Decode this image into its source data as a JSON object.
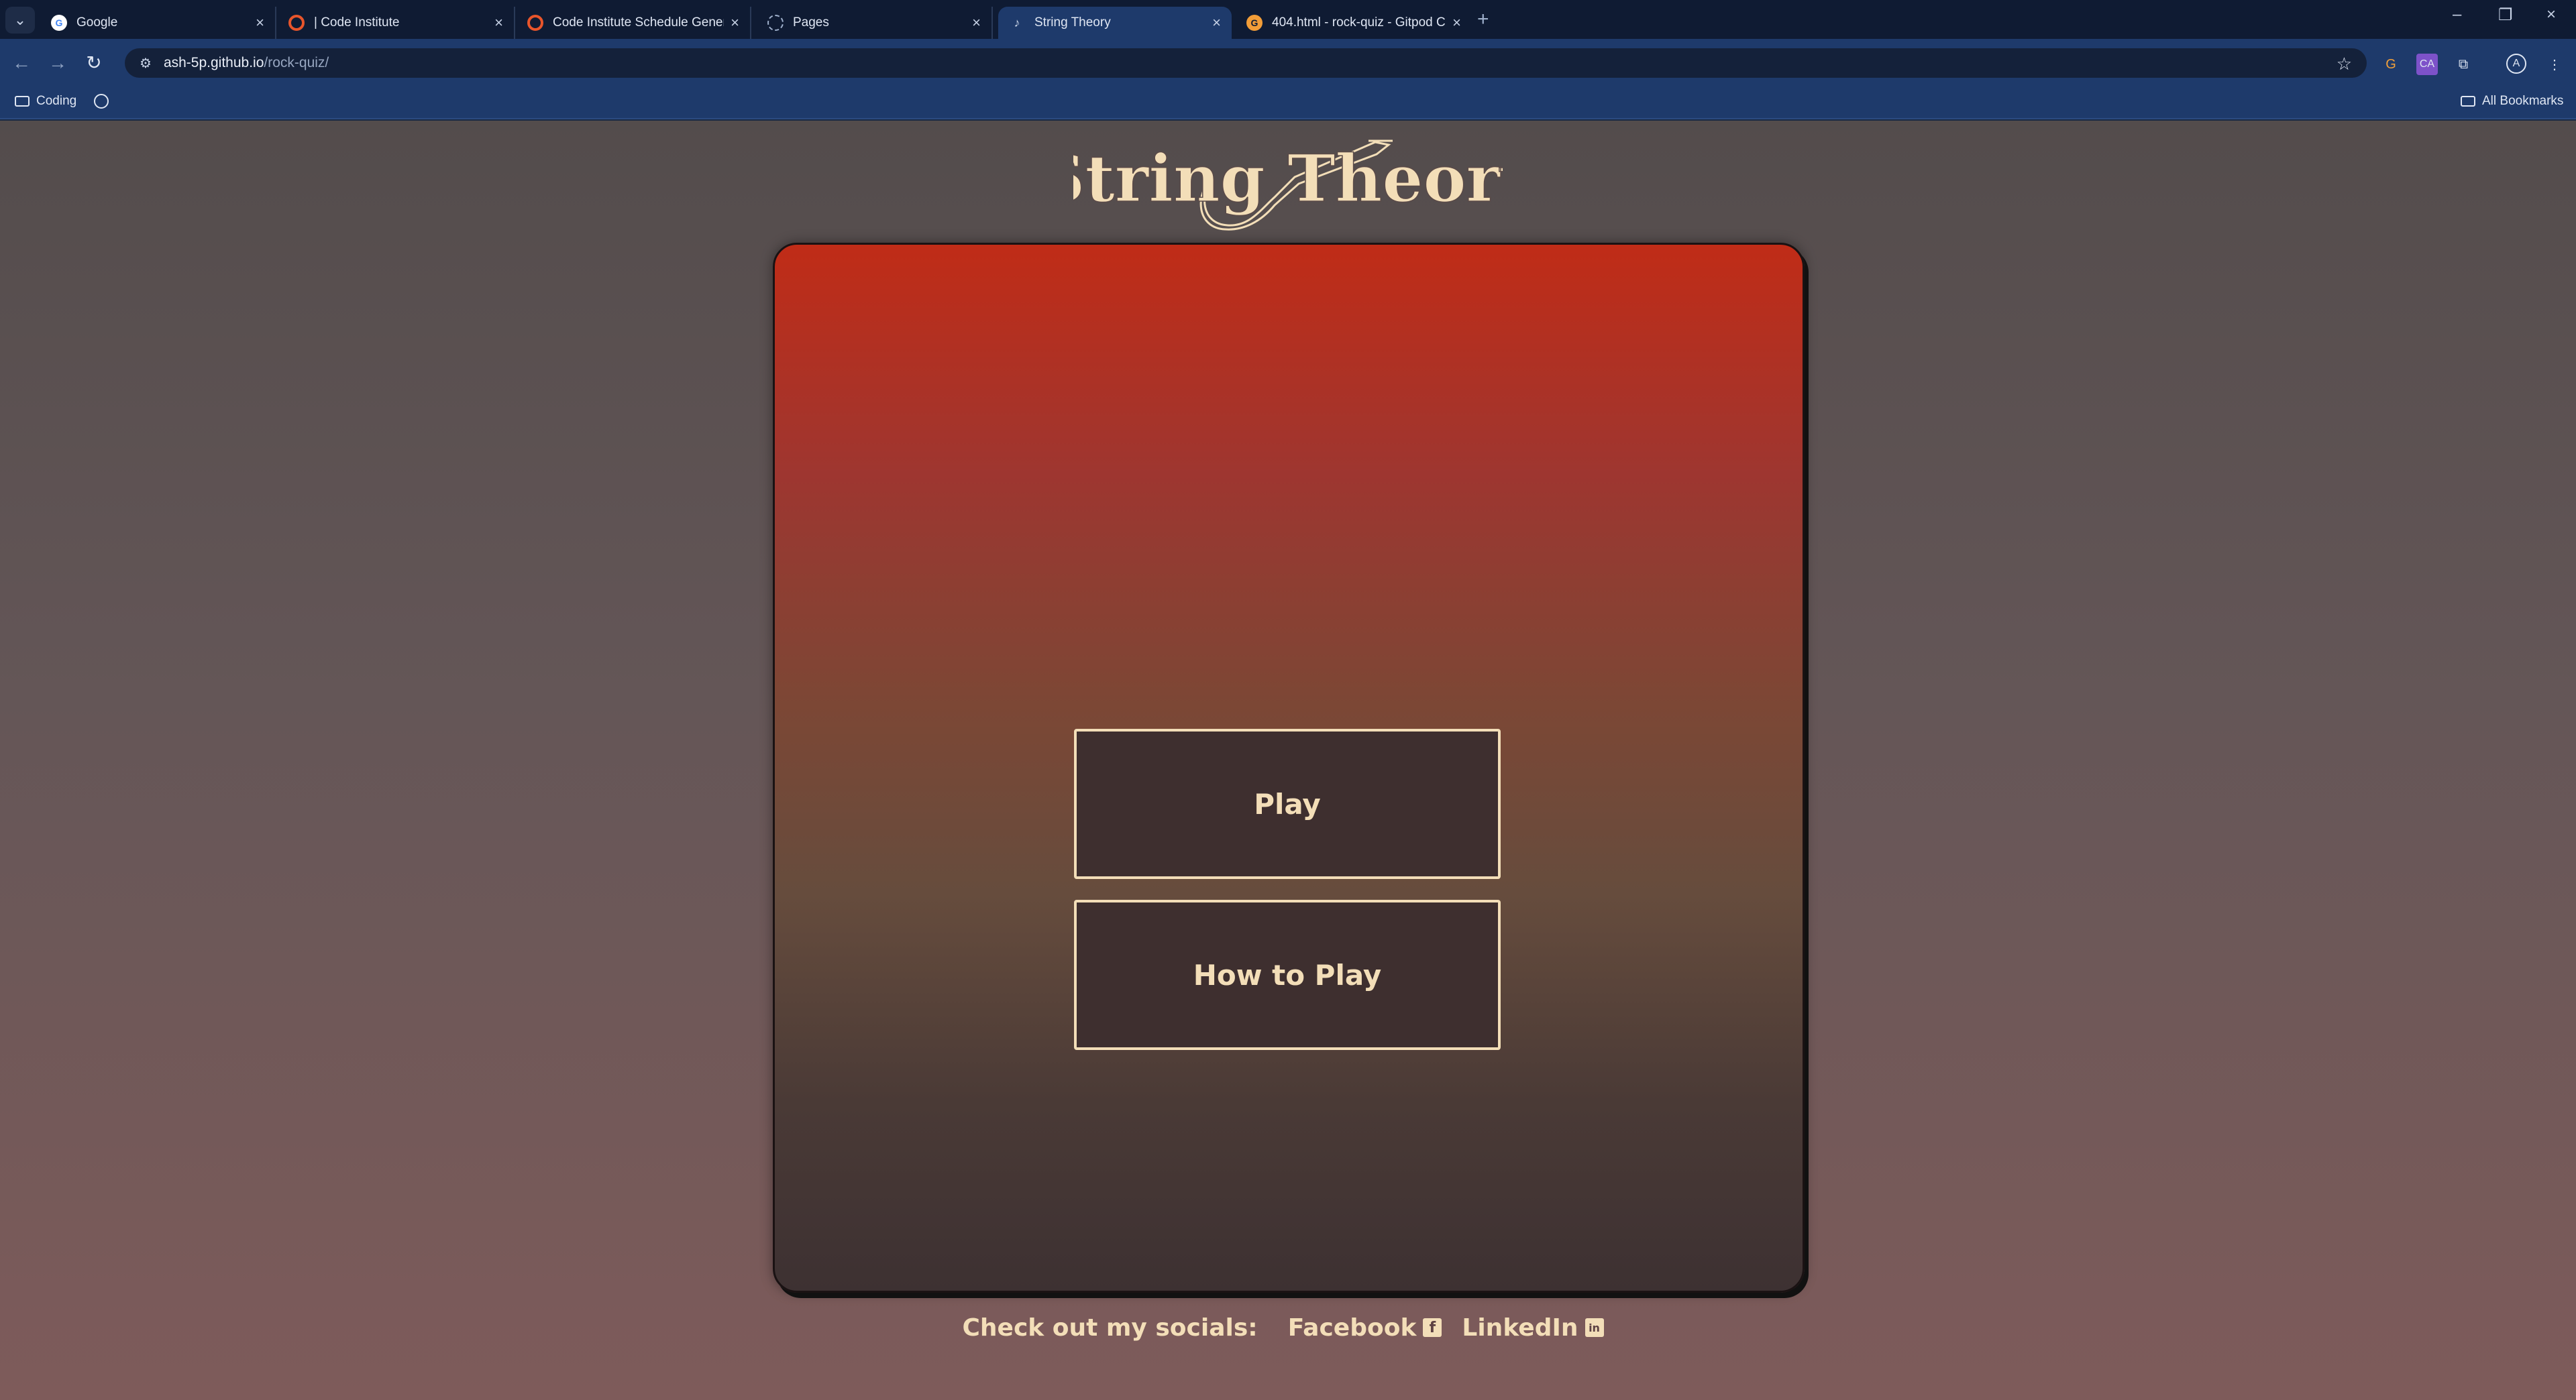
{
  "browser": {
    "tabs": [
      {
        "title": "Google",
        "favicon": "google-icon",
        "active": false
      },
      {
        "title": "| Code Institute",
        "favicon": "code-institute-icon",
        "active": false
      },
      {
        "title": "Code Institute Schedule Genera",
        "favicon": "code-institute-icon",
        "active": false
      },
      {
        "title": "Pages",
        "favicon": "github-icon",
        "active": false
      },
      {
        "title": "String Theory",
        "favicon": "guitar-icon",
        "active": true
      },
      {
        "title": "404.html - rock-quiz - Gitpod C",
        "favicon": "gitpod-icon",
        "active": false
      }
    ],
    "url_host": "ash-5p.github.io",
    "url_path": "/rock-quiz/",
    "bookmarks": {
      "folder_label": "Coding",
      "all_bookmarks_label": "All Bookmarks"
    },
    "profile_initial": "A"
  },
  "page": {
    "logo_text": "String Theory",
    "buttons": {
      "play_label": "Play",
      "how_to_play_label": "How to Play"
    },
    "footer": {
      "label": "Check out my socials:",
      "facebook_label": "Facebook",
      "linkedin_label": "LinkedIn"
    }
  },
  "colors": {
    "accent_cream": "#f3deb8",
    "card_top": "#c02c17",
    "card_bottom": "#3d3132",
    "button_bg": "#3e2f2f",
    "browser_toolbar": "#1e3a6b"
  }
}
